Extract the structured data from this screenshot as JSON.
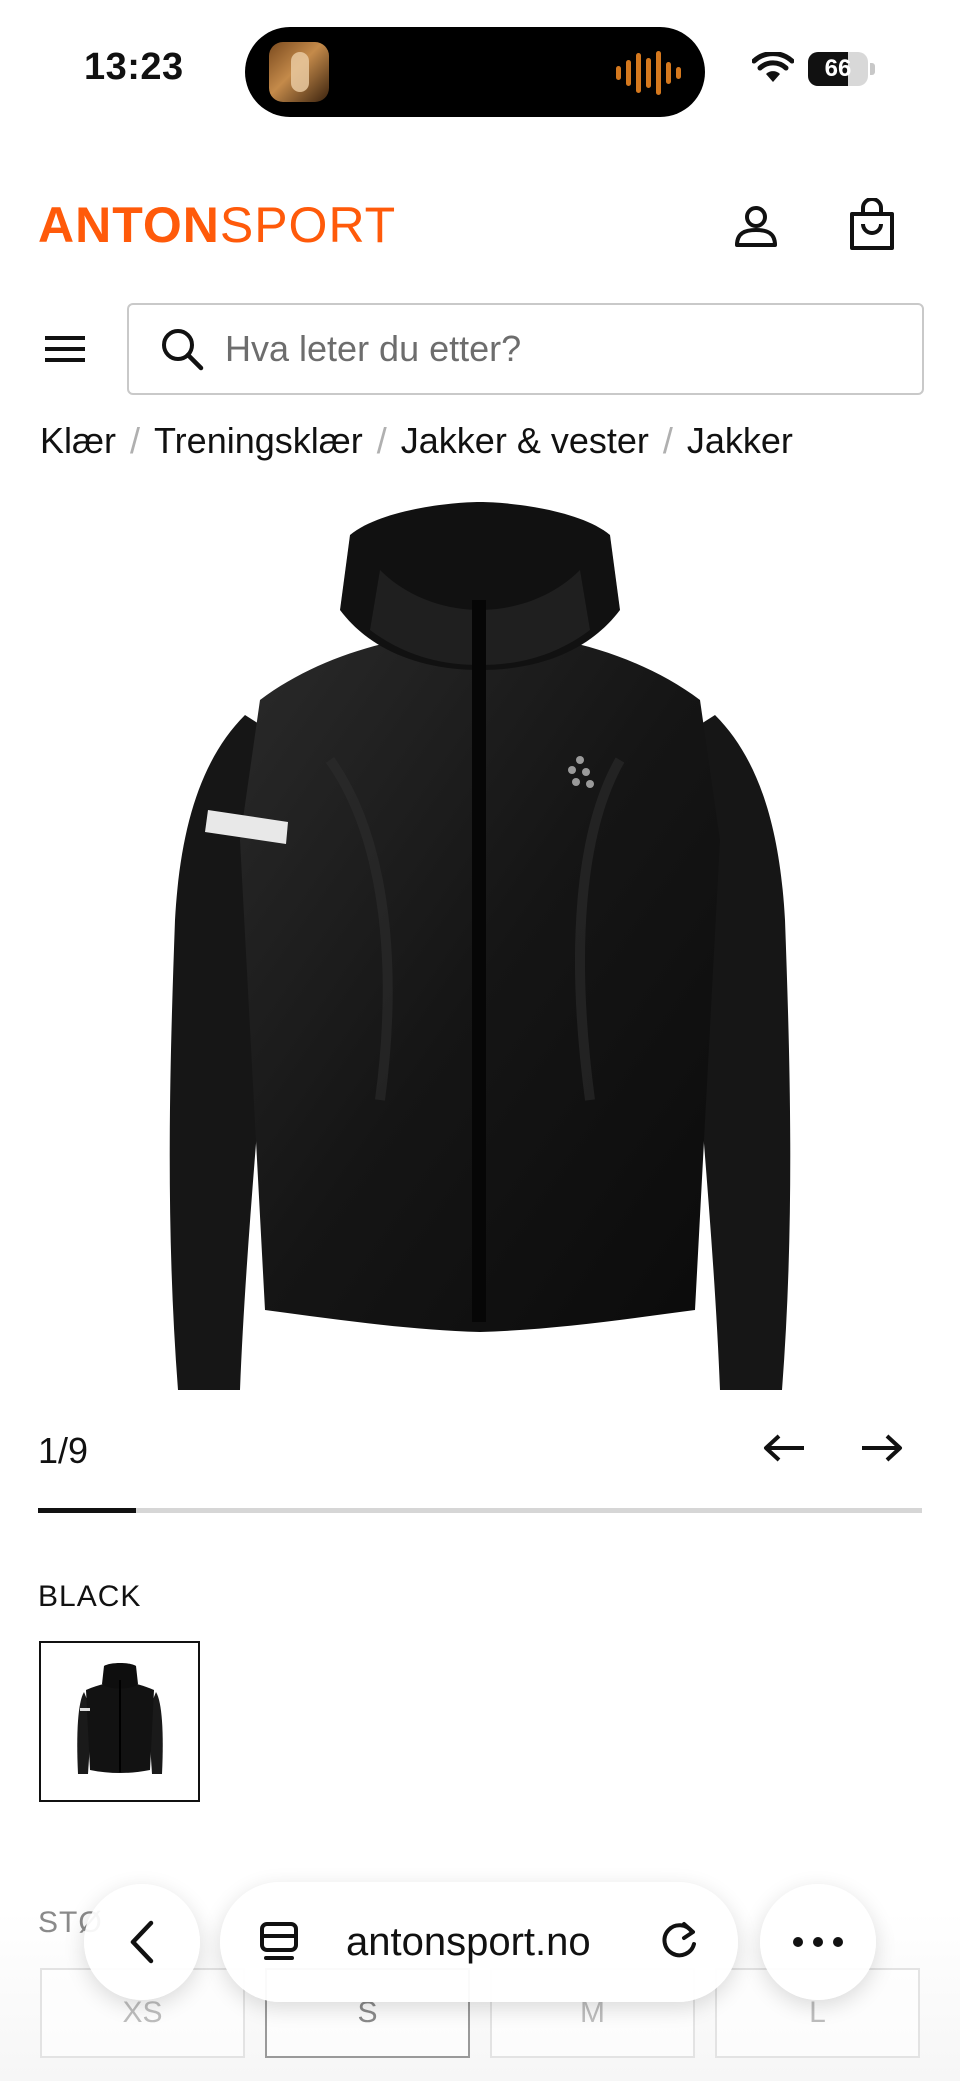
{
  "status_bar": {
    "time": "13:23",
    "battery_percent": "66",
    "battery_level": 0.66
  },
  "header": {
    "logo_bold": "ANTON",
    "logo_light": "SPORT",
    "brand_color": "#ff5a0a",
    "account_icon": "person-icon",
    "cart_icon": "shopping-bag-icon"
  },
  "search": {
    "placeholder": "Hva leter du etter?",
    "value": ""
  },
  "breadcrumb": [
    "Klær",
    "Treningsklær",
    "Jakker & vester",
    "Jakker"
  ],
  "gallery": {
    "counter": "1/9",
    "current": 1,
    "total": 9
  },
  "color": {
    "label": "BLACK"
  },
  "size": {
    "label": "STØ",
    "options": [
      "XS",
      "S",
      "M",
      "L"
    ],
    "selected": "S"
  },
  "browser": {
    "url": "antonsport.no",
    "back_icon": "chevron-left-icon",
    "tabs_icon": "tabs-icon",
    "reload_icon": "reload-icon",
    "more_icon": "more-icon"
  }
}
